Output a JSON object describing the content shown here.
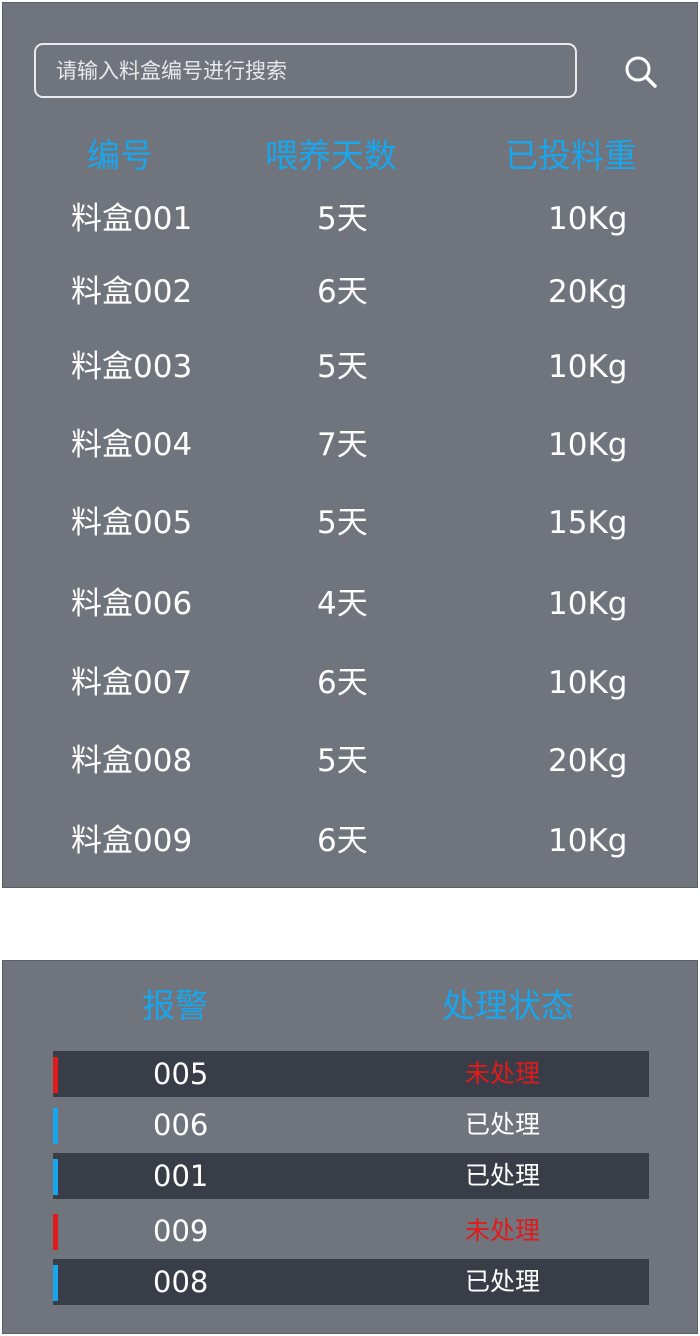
{
  "search": {
    "placeholder": "请输入料盒编号进行搜索",
    "icon": "search-icon"
  },
  "boxes": {
    "headers": {
      "id": "编号",
      "days": "喂养天数",
      "weight": "已投料重"
    },
    "rows": [
      {
        "id": "料盒001",
        "days": "5天",
        "weight": "10Kg"
      },
      {
        "id": "料盒002",
        "days": "6天",
        "weight": "20Kg"
      },
      {
        "id": "料盒003",
        "days": "5天",
        "weight": "10Kg"
      },
      {
        "id": "料盒004",
        "days": "7天",
        "weight": "10Kg"
      },
      {
        "id": "料盒005",
        "days": "5天",
        "weight": "15Kg"
      },
      {
        "id": "料盒006",
        "days": "4天",
        "weight": "10Kg"
      },
      {
        "id": "料盒007",
        "days": "6天",
        "weight": "10Kg"
      },
      {
        "id": "料盒008",
        "days": "5天",
        "weight": "20Kg"
      },
      {
        "id": "料盒009",
        "days": "6天",
        "weight": "10Kg"
      }
    ]
  },
  "alarms": {
    "headers": {
      "alarm": "报警",
      "status": "处理状态"
    },
    "rows": [
      {
        "code": "005",
        "status": "未处理",
        "state": "unhandled"
      },
      {
        "code": "006",
        "status": "已处理",
        "state": "handled"
      },
      {
        "code": "001",
        "status": "已处理",
        "state": "handled"
      },
      {
        "code": "009",
        "status": "未处理",
        "state": "unhandled"
      },
      {
        "code": "008",
        "status": "已处理",
        "state": "handled"
      }
    ]
  },
  "colors": {
    "panel_bg": "#6f747d",
    "header_blue": "#1aa6ec",
    "unhandled_red": "#e01b1b",
    "handled_text": "#ffffff",
    "handled_marker": "#1aa6ec",
    "unhandled_marker": "#e01b1b",
    "dark_row": "#383d48"
  }
}
